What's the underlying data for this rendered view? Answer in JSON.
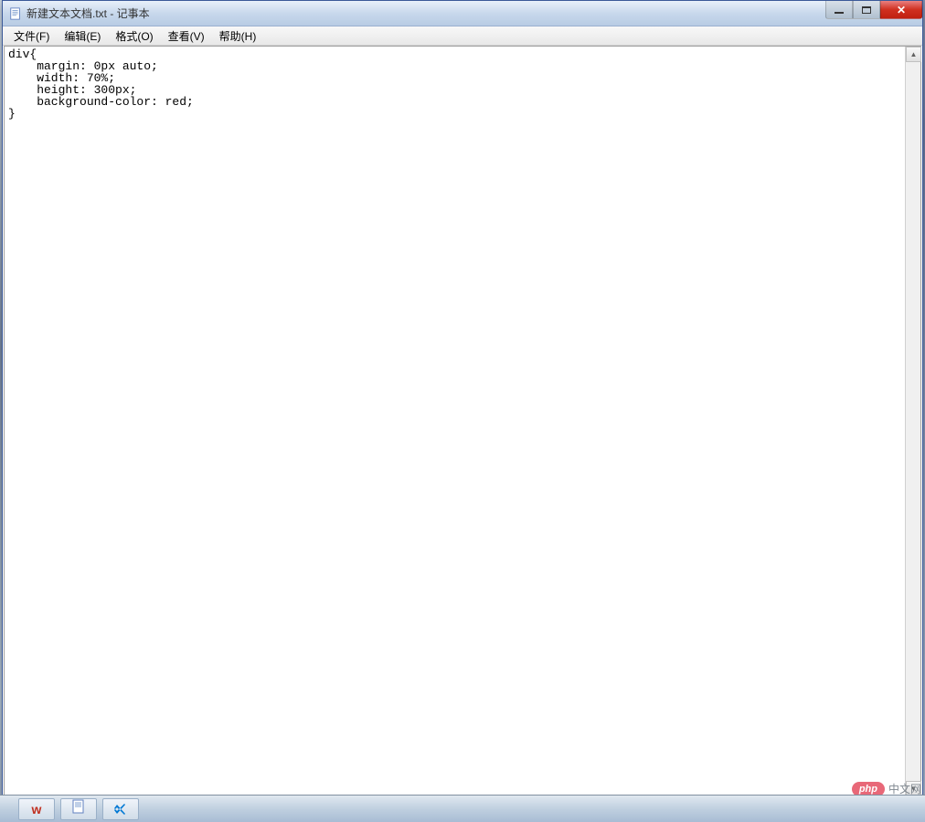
{
  "window": {
    "title": "新建文本文档.txt - 记事本"
  },
  "menu": {
    "file": "文件(F)",
    "edit": "编辑(E)",
    "format": "格式(O)",
    "view": "查看(V)",
    "help": "帮助(H)"
  },
  "editor": {
    "content": "div{\n    margin: 0px auto;\n    width: 70%;\n    height: 300px;\n    background-color: red;\n}"
  },
  "watermark": {
    "logo": "php",
    "text": "中文网"
  },
  "taskbar": {
    "icon_w": "w"
  }
}
